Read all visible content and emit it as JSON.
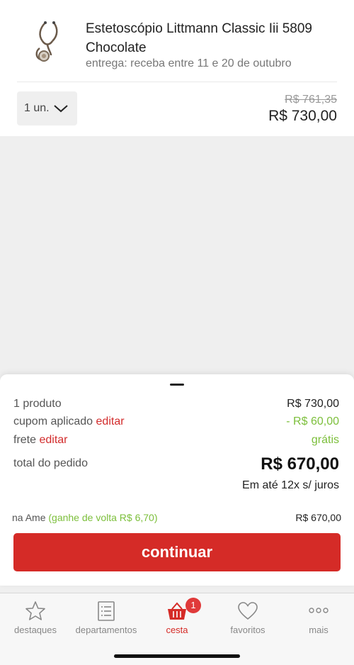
{
  "product": {
    "title": "Estetoscópio Littmann Classic Iii 5809 Chocolate",
    "delivery": "entrega: receba entre 11 e 20 de outubro",
    "quantity": "1 un.",
    "old_price": "R$ 761,35",
    "price": "R$ 730,00",
    "thumbnail_icon": "stethoscope-icon"
  },
  "summary": {
    "products_label": "1 produto",
    "products_value": "R$ 730,00",
    "coupon_label": "cupom aplicado",
    "coupon_edit": "editar",
    "coupon_value": "- R$ 60,00",
    "shipping_label": "frete",
    "shipping_edit": "editar",
    "shipping_value": "grátis",
    "total_label": "total do pedido",
    "total_value": "R$ 670,00",
    "installments": "Em até 12x s/ juros",
    "ame_label": "na Ame",
    "ame_cashback": "(ganhe de volta R$ 6,70)",
    "ame_value": "R$ 670,00",
    "continue_label": "continuar"
  },
  "tabbar": {
    "tabs": [
      {
        "label": "destaques",
        "icon": "star-icon"
      },
      {
        "label": "departamentos",
        "icon": "list-icon"
      },
      {
        "label": "cesta",
        "icon": "basket-icon"
      },
      {
        "label": "favoritos",
        "icon": "heart-icon"
      },
      {
        "label": "mais",
        "icon": "more-icon"
      }
    ],
    "cart_badge": "1"
  },
  "colors": {
    "accent_red": "#d52b27",
    "green": "#7cbf3b"
  }
}
